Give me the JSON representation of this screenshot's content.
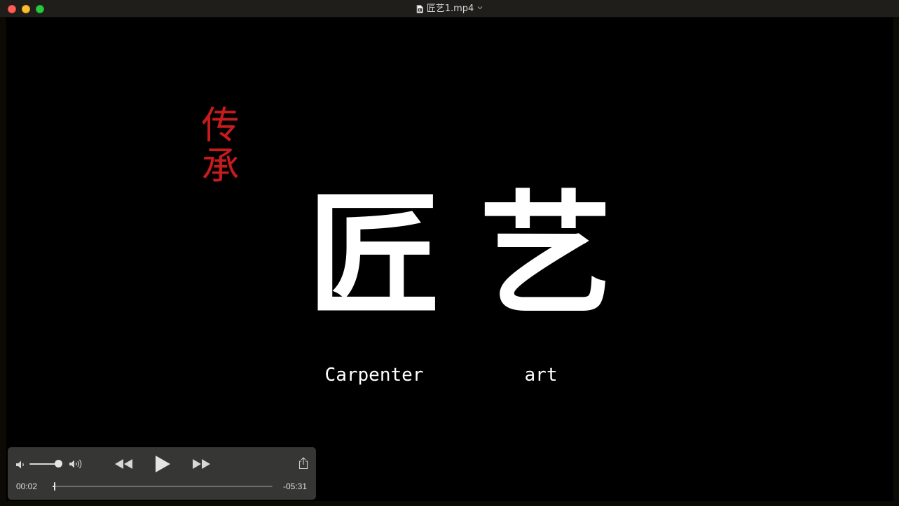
{
  "window": {
    "title": "匠艺1.mp4",
    "title_icon": "document-icon",
    "menu_icon": "chevron-down-icon",
    "buttons": {
      "close_color": "#fe5f57",
      "minimize_color": "#febc2e",
      "zoom_color": "#28c840"
    }
  },
  "video_frame": {
    "vertical_red_text": "传承",
    "red_color": "#c81b1b",
    "char_one": "匠",
    "char_two": "艺",
    "caption_one": "Carpenter",
    "caption_two": "art"
  },
  "controls": {
    "volume_low_icon": "speaker-low-icon",
    "volume_high_icon": "speaker-high-icon",
    "volume_level": 0.9,
    "rewind_icon": "rewind-icon",
    "play_icon": "play-icon",
    "fast_forward_icon": "fast-forward-icon",
    "share_icon": "share-icon",
    "current_time": "00:02",
    "remaining_time": "-05:31",
    "progress": 0.006
  }
}
